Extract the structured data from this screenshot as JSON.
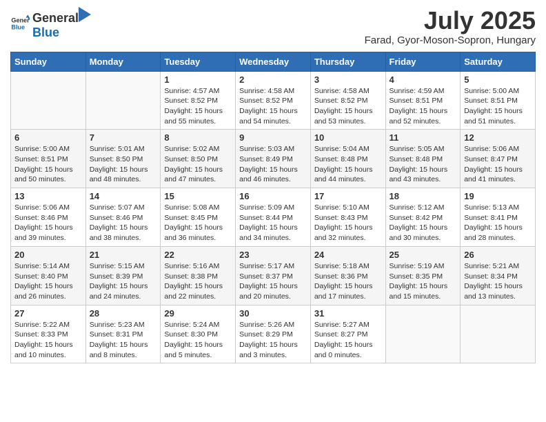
{
  "logo": {
    "text_general": "General",
    "text_blue": "Blue"
  },
  "title": "July 2025",
  "subtitle": "Farad, Gyor-Moson-Sopron, Hungary",
  "weekdays": [
    "Sunday",
    "Monday",
    "Tuesday",
    "Wednesday",
    "Thursday",
    "Friday",
    "Saturday"
  ],
  "weeks": [
    [
      {
        "day": "",
        "info": ""
      },
      {
        "day": "",
        "info": ""
      },
      {
        "day": "1",
        "info": "Sunrise: 4:57 AM\nSunset: 8:52 PM\nDaylight: 15 hours and 55 minutes."
      },
      {
        "day": "2",
        "info": "Sunrise: 4:58 AM\nSunset: 8:52 PM\nDaylight: 15 hours and 54 minutes."
      },
      {
        "day": "3",
        "info": "Sunrise: 4:58 AM\nSunset: 8:52 PM\nDaylight: 15 hours and 53 minutes."
      },
      {
        "day": "4",
        "info": "Sunrise: 4:59 AM\nSunset: 8:51 PM\nDaylight: 15 hours and 52 minutes."
      },
      {
        "day": "5",
        "info": "Sunrise: 5:00 AM\nSunset: 8:51 PM\nDaylight: 15 hours and 51 minutes."
      }
    ],
    [
      {
        "day": "6",
        "info": "Sunrise: 5:00 AM\nSunset: 8:51 PM\nDaylight: 15 hours and 50 minutes."
      },
      {
        "day": "7",
        "info": "Sunrise: 5:01 AM\nSunset: 8:50 PM\nDaylight: 15 hours and 48 minutes."
      },
      {
        "day": "8",
        "info": "Sunrise: 5:02 AM\nSunset: 8:50 PM\nDaylight: 15 hours and 47 minutes."
      },
      {
        "day": "9",
        "info": "Sunrise: 5:03 AM\nSunset: 8:49 PM\nDaylight: 15 hours and 46 minutes."
      },
      {
        "day": "10",
        "info": "Sunrise: 5:04 AM\nSunset: 8:48 PM\nDaylight: 15 hours and 44 minutes."
      },
      {
        "day": "11",
        "info": "Sunrise: 5:05 AM\nSunset: 8:48 PM\nDaylight: 15 hours and 43 minutes."
      },
      {
        "day": "12",
        "info": "Sunrise: 5:06 AM\nSunset: 8:47 PM\nDaylight: 15 hours and 41 minutes."
      }
    ],
    [
      {
        "day": "13",
        "info": "Sunrise: 5:06 AM\nSunset: 8:46 PM\nDaylight: 15 hours and 39 minutes."
      },
      {
        "day": "14",
        "info": "Sunrise: 5:07 AM\nSunset: 8:46 PM\nDaylight: 15 hours and 38 minutes."
      },
      {
        "day": "15",
        "info": "Sunrise: 5:08 AM\nSunset: 8:45 PM\nDaylight: 15 hours and 36 minutes."
      },
      {
        "day": "16",
        "info": "Sunrise: 5:09 AM\nSunset: 8:44 PM\nDaylight: 15 hours and 34 minutes."
      },
      {
        "day": "17",
        "info": "Sunrise: 5:10 AM\nSunset: 8:43 PM\nDaylight: 15 hours and 32 minutes."
      },
      {
        "day": "18",
        "info": "Sunrise: 5:12 AM\nSunset: 8:42 PM\nDaylight: 15 hours and 30 minutes."
      },
      {
        "day": "19",
        "info": "Sunrise: 5:13 AM\nSunset: 8:41 PM\nDaylight: 15 hours and 28 minutes."
      }
    ],
    [
      {
        "day": "20",
        "info": "Sunrise: 5:14 AM\nSunset: 8:40 PM\nDaylight: 15 hours and 26 minutes."
      },
      {
        "day": "21",
        "info": "Sunrise: 5:15 AM\nSunset: 8:39 PM\nDaylight: 15 hours and 24 minutes."
      },
      {
        "day": "22",
        "info": "Sunrise: 5:16 AM\nSunset: 8:38 PM\nDaylight: 15 hours and 22 minutes."
      },
      {
        "day": "23",
        "info": "Sunrise: 5:17 AM\nSunset: 8:37 PM\nDaylight: 15 hours and 20 minutes."
      },
      {
        "day": "24",
        "info": "Sunrise: 5:18 AM\nSunset: 8:36 PM\nDaylight: 15 hours and 17 minutes."
      },
      {
        "day": "25",
        "info": "Sunrise: 5:19 AM\nSunset: 8:35 PM\nDaylight: 15 hours and 15 minutes."
      },
      {
        "day": "26",
        "info": "Sunrise: 5:21 AM\nSunset: 8:34 PM\nDaylight: 15 hours and 13 minutes."
      }
    ],
    [
      {
        "day": "27",
        "info": "Sunrise: 5:22 AM\nSunset: 8:33 PM\nDaylight: 15 hours and 10 minutes."
      },
      {
        "day": "28",
        "info": "Sunrise: 5:23 AM\nSunset: 8:31 PM\nDaylight: 15 hours and 8 minutes."
      },
      {
        "day": "29",
        "info": "Sunrise: 5:24 AM\nSunset: 8:30 PM\nDaylight: 15 hours and 5 minutes."
      },
      {
        "day": "30",
        "info": "Sunrise: 5:26 AM\nSunset: 8:29 PM\nDaylight: 15 hours and 3 minutes."
      },
      {
        "day": "31",
        "info": "Sunrise: 5:27 AM\nSunset: 8:27 PM\nDaylight: 15 hours and 0 minutes."
      },
      {
        "day": "",
        "info": ""
      },
      {
        "day": "",
        "info": ""
      }
    ]
  ]
}
